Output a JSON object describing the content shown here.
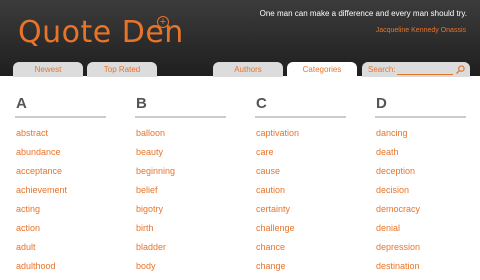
{
  "header": {
    "logo": "Quote Den",
    "logo_plus": "+",
    "quote": "One man can make a difference and every man should try.",
    "quote_author": "Jacqueline Kennedy Onassis"
  },
  "tabs": [
    {
      "label": "Newest"
    },
    {
      "label": "Top Rated"
    },
    {
      "label": "Authors"
    },
    {
      "label": "Categories",
      "active": true
    }
  ],
  "search": {
    "label": "Search:",
    "placeholder": "",
    "icon": "search-icon"
  },
  "columns": [
    {
      "letter": "A",
      "items": [
        "abstract",
        "abundance",
        "acceptance",
        "achievement",
        "acting",
        "action",
        "adult",
        "adulthood"
      ]
    },
    {
      "letter": "B",
      "items": [
        "balloon",
        "beauty",
        "beginning",
        "belief",
        "bigotry",
        "birth",
        "bladder",
        "body"
      ]
    },
    {
      "letter": "C",
      "items": [
        "captivation",
        "care",
        "cause",
        "caution",
        "certainty",
        "challenge",
        "chance",
        "change"
      ]
    },
    {
      "letter": "D",
      "items": [
        "dancing",
        "death",
        "deception",
        "decision",
        "democracy",
        "denial",
        "depression",
        "destination"
      ]
    }
  ],
  "colors": {
    "accent": "#e8742a",
    "header_bg": "#2a2a2a",
    "tab_bg": "#dcdcdc",
    "heading": "#555555"
  }
}
